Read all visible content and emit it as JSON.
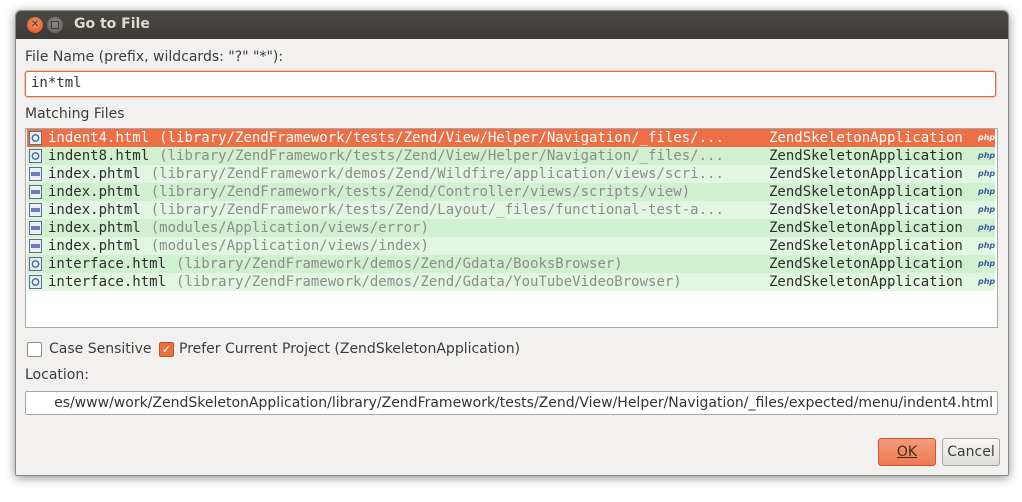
{
  "window": {
    "title": "Go to File"
  },
  "filename": {
    "label": "File Name (prefix, wildcards: \"?\" \"*\"):",
    "value": "in*tml"
  },
  "matching": {
    "label": "Matching Files",
    "rows": [
      {
        "name": "indent4.html",
        "path": "(library/ZendFramework/tests/Zend/View/Helper/Navigation/_files/...",
        "project": "ZendSkeletonApplication",
        "type": "html-file-icon",
        "selected": true
      },
      {
        "name": "indent8.html",
        "path": "(library/ZendFramework/tests/Zend/View/Helper/Navigation/_files/...",
        "project": "ZendSkeletonApplication",
        "type": "html-file-icon",
        "selected": false
      },
      {
        "name": "index.phtml",
        "path": "(library/ZendFramework/demos/Zend/Wildfire/application/views/scri...",
        "project": "ZendSkeletonApplication",
        "type": "php-file-icon",
        "selected": false
      },
      {
        "name": "index.phtml",
        "path": "(library/ZendFramework/tests/Zend/Controller/views/scripts/view)",
        "project": "ZendSkeletonApplication",
        "type": "php-file-icon",
        "selected": false
      },
      {
        "name": "index.phtml",
        "path": "(library/ZendFramework/tests/Zend/Layout/_files/functional-test-a...",
        "project": "ZendSkeletonApplication",
        "type": "php-file-icon",
        "selected": false
      },
      {
        "name": "index.phtml",
        "path": "(modules/Application/views/error)",
        "project": "ZendSkeletonApplication",
        "type": "php-file-icon",
        "selected": false
      },
      {
        "name": "index.phtml",
        "path": "(modules/Application/views/index)",
        "project": "ZendSkeletonApplication",
        "type": "php-file-icon",
        "selected": false
      },
      {
        "name": "interface.html",
        "path": "(library/ZendFramework/demos/Zend/Gdata/BooksBrowser)",
        "project": "ZendSkeletonApplication",
        "type": "html-file-icon",
        "selected": false
      },
      {
        "name": "interface.html",
        "path": "(library/ZendFramework/demos/Zend/Gdata/YouTubeVideoBrowser)",
        "project": "ZendSkeletonApplication",
        "type": "html-file-icon",
        "selected": false
      }
    ],
    "project_icon_text": "php"
  },
  "options": {
    "case_sensitive": {
      "label": "Case Sensitive",
      "checked": false
    },
    "prefer_current": {
      "label": "Prefer Current Project (ZendSkeletonApplication)",
      "checked": true
    }
  },
  "location": {
    "label": "Location:",
    "value": "es/www/work/ZendSkeletonApplication/library/ZendFramework/tests/Zend/View/Helper/Navigation/_files/expected/menu/indent4.html"
  },
  "buttons": {
    "ok": "OK",
    "cancel": "Cancel"
  },
  "colors": {
    "accent": "#ee6e46",
    "row_green_light": "#e2f7e2",
    "row_green": "#d0f0d0"
  }
}
